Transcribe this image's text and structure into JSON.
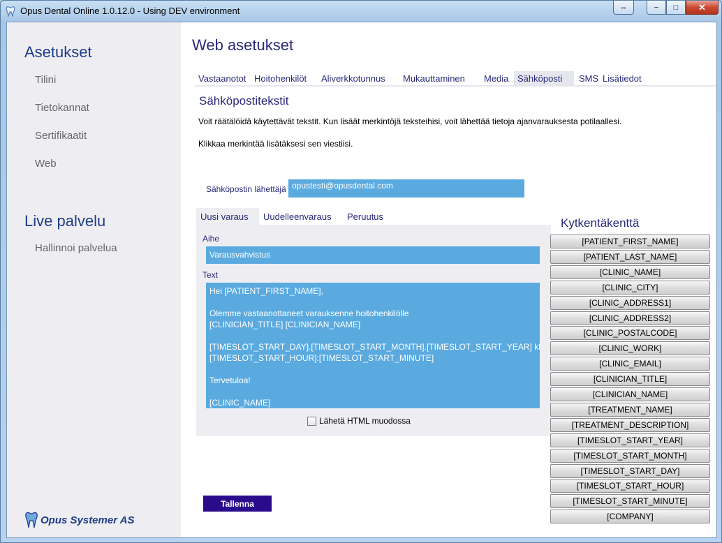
{
  "window": {
    "title": "Opus Dental Online 1.0.12.0 - Using DEV environment",
    "buttons": {
      "extra": "⇔",
      "minimize": "−",
      "maximize": "□",
      "close": "✕"
    }
  },
  "sidebar": {
    "heading1": "Asetukset",
    "items1": [
      "Tilini",
      "Tietokannat",
      "Sertifikaatit",
      "Web"
    ],
    "heading2": "Live palvelu",
    "items2": [
      "Hallinnoi palvelua"
    ],
    "logo_text": "Opus Systemer AS"
  },
  "main": {
    "page_title": "Web asetukset",
    "tabs": [
      "Vastaanotot",
      "Hoitohenkilöt",
      "Aliverkkotunnus",
      "Mukauttaminen",
      "Media",
      "Sähköposti",
      "SMS",
      "Lisätiedot"
    ],
    "active_tab": "Sähköposti",
    "section_title": "Sähköpostitekstit",
    "desc1": "Voit räätälöidä käytettävät tekstit. Kun lisäät merkintöjä teksteihisi, voit lähettää tietoja ajanvarauksesta potilaallesi.",
    "desc2": "Klikkaa merkintää lisätäksesi sen viestiisi.",
    "sender_label": "Sähköpostin lähettäjä",
    "sender_value": "opustesti@opusdental.com",
    "subtabs": [
      "Uusi varaus",
      "Uudelleenvaraus",
      "Peruutus"
    ],
    "subject_label": "Aihe",
    "subject_value": "Varausvahvistus",
    "text_label": "Text",
    "text_value": "Hei [PATIENT_FIRST_NAME],\n\nOlemme vastaanottaneet varauksenne hoitohenkilölle\n[CLINICIAN_TITLE] [CLINICIAN_NAME]\n\n[TIMESLOT_START_DAY].[TIMESLOT_START_MONTH].[TIMESLOT_START_YEAR] klo\n[TIMESLOT_START_HOUR]:[TIMESLOT_START_MINUTE]\n\nTervetuloa!\n\n[CLINIC_NAME]",
    "html_checkbox_label": "Lähetä HTML muodossa",
    "html_checked": false,
    "save_label": "Tallenna"
  },
  "fields": {
    "title": "Kytkentäkenttä",
    "items": [
      "[PATIENT_FIRST_NAME]",
      "[PATIENT_LAST_NAME]",
      "[CLINIC_NAME]",
      "[CLINIC_CITY]",
      "[CLINIC_ADDRESS1]",
      "[CLINIC_ADDRESS2]",
      "[CLINIC_POSTALCODE]",
      "[CLINIC_WORK]",
      "[CLINIC_EMAIL]",
      "[CLINICIAN_TITLE]",
      "[CLINICIAN_NAME]",
      "[TREATMENT_NAME]",
      "[TREATMENT_DESCRIPTION]",
      "[TIMESLOT_START_YEAR]",
      "[TIMESLOT_START_MONTH]",
      "[TIMESLOT_START_DAY]",
      "[TIMESLOT_START_HOUR]",
      "[TIMESLOT_START_MINUTE]",
      "[COMPANY]"
    ]
  },
  "colors": {
    "accent": "#5aaae0",
    "heading": "#2a2a7a",
    "save_button": "#2a0b8c"
  }
}
